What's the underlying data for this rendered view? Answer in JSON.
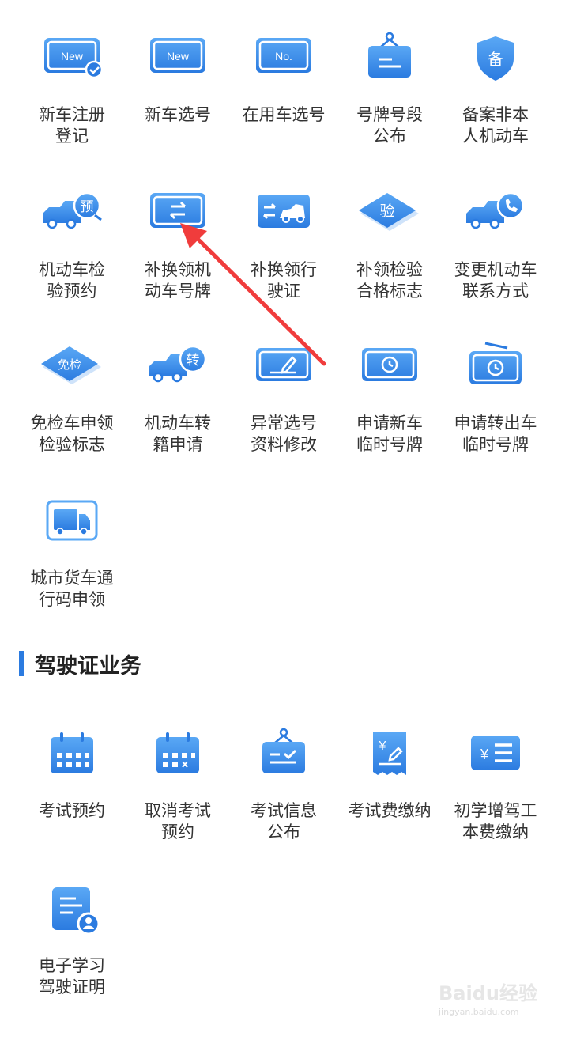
{
  "colors": {
    "accent": "#2b7be0",
    "accent_light": "#5aa8f5",
    "arrow": "#f03c3c"
  },
  "vehicle_services": [
    {
      "label": "新车注册\n登记",
      "icon": "new-plate-check-icon"
    },
    {
      "label": "新车选号",
      "icon": "new-plate-icon"
    },
    {
      "label": "在用车选号",
      "icon": "no-plate-icon"
    },
    {
      "label": "号牌号段\n公布",
      "icon": "hanging-board-icon"
    },
    {
      "label": "备案非本\n人机动车",
      "icon": "shield-record-icon"
    },
    {
      "label": "机动车检\n验预约",
      "icon": "car-reserve-icon"
    },
    {
      "label": "补换领机\n动车号牌",
      "icon": "plate-exchange-icon"
    },
    {
      "label": "补换领行\n驶证",
      "icon": "license-exchange-icon"
    },
    {
      "label": "补领检验\n合格标志",
      "icon": "inspection-diamond-icon"
    },
    {
      "label": "变更机动车\n联系方式",
      "icon": "car-phone-icon"
    },
    {
      "label": "免检车申领\n检验标志",
      "icon": "exempt-diamond-icon"
    },
    {
      "label": "机动车转\n籍申请",
      "icon": "car-transfer-icon"
    },
    {
      "label": "异常选号\n资料修改",
      "icon": "edit-plate-icon"
    },
    {
      "label": "申请新车\n临时号牌",
      "icon": "temp-plate-clock-icon"
    },
    {
      "label": "申请转出车\n临时号牌",
      "icon": "temp-plate-hanging-icon"
    },
    {
      "label": "城市货车通\n行码申领",
      "icon": "truck-pass-icon"
    }
  ],
  "vehicle_icon_text": {
    "new": "New",
    "no": "No.",
    "record": "备",
    "reserve": "预",
    "inspect": "验",
    "exempt": "免检",
    "transfer": "转"
  },
  "section": {
    "title": "驾驶证业务"
  },
  "license_services": [
    {
      "label": "考试预约",
      "icon": "calendar-icon"
    },
    {
      "label": "取消考试\n预约",
      "icon": "calendar-cancel-icon"
    },
    {
      "label": "考试信息\n公布",
      "icon": "info-board-icon"
    },
    {
      "label": "考试费缴纳",
      "icon": "fee-receipt-icon"
    },
    {
      "label": "初学增驾工\n本费缴纳",
      "icon": "fee-list-icon"
    },
    {
      "label": "电子学习\n驾驶证明",
      "icon": "doc-person-icon"
    }
  ],
  "watermark": {
    "text": "Baidu经验",
    "sub": "jingyan.baidu.com"
  }
}
